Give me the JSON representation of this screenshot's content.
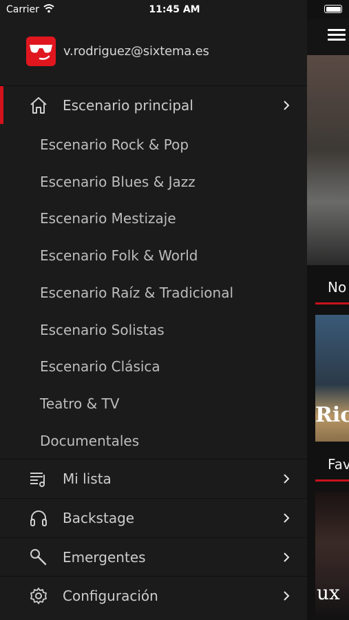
{
  "status_bar": {
    "carrier": "Carrier",
    "time": "11:45 AM"
  },
  "profile": {
    "email": "v.rodriguez@sixtema.es"
  },
  "menu": {
    "main_stage": {
      "label": "Escenario principal",
      "icon": "home-icon"
    },
    "sub_items": [
      "Escenario Rock & Pop",
      "Escenario Blues & Jazz",
      "Escenario Mestizaje",
      "Escenario Folk & World",
      "Escenario Raíz & Tradicional",
      "Escenario Solistas",
      "Escenario Clásica",
      "Teatro & TV",
      "Documentales"
    ],
    "items": [
      {
        "label": "Mi lista",
        "icon": "playlist-icon"
      },
      {
        "label": "Backstage",
        "icon": "headphones-icon"
      },
      {
        "label": "Emergentes",
        "icon": "microphone-icon"
      },
      {
        "label": "Configuración",
        "icon": "gear-icon"
      }
    ]
  },
  "content": {
    "section1_title": "No",
    "section2_title": "Fav",
    "thumb1_text": "Ric",
    "thumb2_text": "ux"
  },
  "colors": {
    "accent": "#d3121c",
    "background": "#1b1b1b",
    "avatar": "#e0161f"
  }
}
